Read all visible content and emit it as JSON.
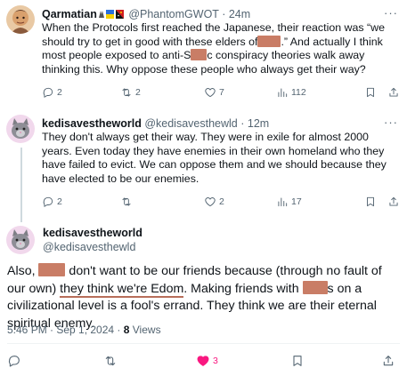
{
  "tweet1": {
    "name": "Qarmatian",
    "handle": "@PhantomGWOT",
    "separator": "·",
    "time": "24m",
    "text_line1": "When the Protocols first reached the Japanese, their reaction was “we",
    "text_line2a": "should try to get in good with these elders of",
    "text_line2b": ".”  And actually I think",
    "text_line3": "most people exposed to anti-S",
    "text_line3b": "c conspiracy theories walk away",
    "text_line4": "thinking this.  Why oppose these people who always get their way?",
    "replies": "2",
    "reposts": "2",
    "likes": "7",
    "views": "112"
  },
  "tweet2": {
    "name": "kedisavestheworld",
    "handle": "@kedisavesthewld",
    "separator": "·",
    "time": "12m",
    "text": "They don't always get their way. They were in exile for almost 2000 years. Even today they have enemies in their own homeland who they have failed to evict. We can oppose them and we should because they have elected to be our enemies.",
    "replies": "2",
    "reposts": "",
    "likes": "2",
    "views": "17"
  },
  "main": {
    "name": "kedisavestheworld",
    "handle": "@kedisavesthewld",
    "text_a": "Also, ",
    "text_b": " don't want to be our friends because (through no fault of our own) ",
    "text_c": "they think we're Edom",
    "text_d": ". Making friends with ",
    "text_e": "s on a civilizational level is a fool's errand. They think we are their eternal spiritual enemy.",
    "time": "5:46 PM · Sep 1, 2024 · ",
    "views_count": "8",
    "views_label": " Views",
    "likes": "3"
  },
  "icons": [
    "reply-icon",
    "repost-icon",
    "like-icon",
    "views-icon",
    "bookmark-icon",
    "share-icon",
    "more-icon"
  ],
  "colors": {
    "like_active": "#f91880",
    "muted": "#536471",
    "redaction": "#c97d66"
  }
}
